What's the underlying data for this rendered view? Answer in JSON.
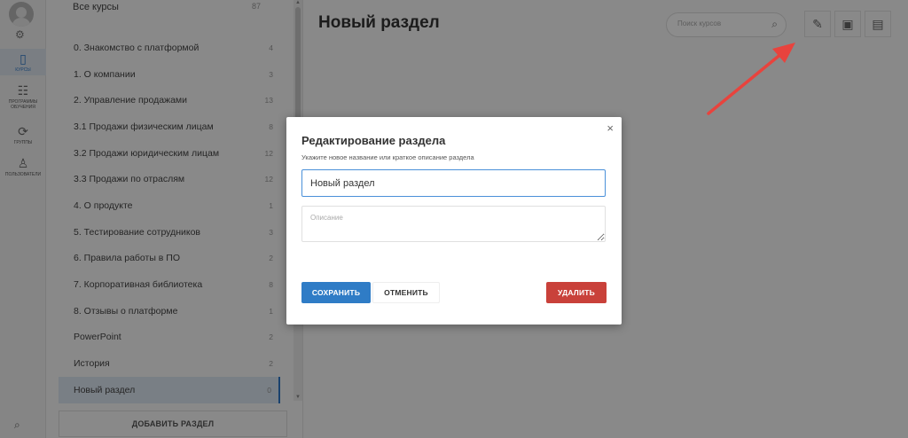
{
  "nav": {
    "items": [
      {
        "icon": "book-icon",
        "label": "КУРСЫ",
        "active": true
      },
      {
        "icon": "list-icon",
        "label": "ПРОГРАММЫ ОБУЧЕНИЯ",
        "active": false
      },
      {
        "icon": "groups-icon",
        "label": "ГРУППЫ",
        "active": false
      },
      {
        "icon": "users-icon",
        "label": "ПОЛЬЗОВАТЕЛИ",
        "active": false
      }
    ]
  },
  "sidebar": {
    "all_courses": {
      "label": "Все курсы",
      "count": "87"
    },
    "sections": [
      {
        "label": "0. Знакомство с платформой",
        "count": "4"
      },
      {
        "label": "1. О компании",
        "count": "3"
      },
      {
        "label": "2. Управление продажами",
        "count": "13"
      },
      {
        "label": "3.1 Продажи физическим лицам",
        "count": "8"
      },
      {
        "label": "3.2 Продажи юридическим лицам",
        "count": "12"
      },
      {
        "label": "3.3 Продажи по отраслям",
        "count": "12"
      },
      {
        "label": "4. О продукте",
        "count": "1"
      },
      {
        "label": "5. Тестирование сотрудников",
        "count": "3"
      },
      {
        "label": "6. Правила работы в ПО",
        "count": "2"
      },
      {
        "label": "7. Корпоративная библиотека",
        "count": "8"
      },
      {
        "label": "8. Отзывы о платформе",
        "count": "1"
      },
      {
        "label": "PowerPoint",
        "count": "2"
      },
      {
        "label": "История",
        "count": "2"
      },
      {
        "label": "Новый раздел",
        "count": "0"
      }
    ],
    "add_section_label": "ДОБАВИТЬ РАЗДЕЛ"
  },
  "main": {
    "title": "Новый раздел",
    "search_placeholder": "Поиск курсов"
  },
  "modal": {
    "title": "Редактирование раздела",
    "subtitle": "Укажите новое название или краткое описание раздела",
    "name_value": "Новый раздел",
    "description_placeholder": "Описание",
    "save_label": "СОХРАНИТЬ",
    "cancel_label": "ОТМЕНИТЬ",
    "delete_label": "УДАЛИТЬ"
  },
  "colors": {
    "accent": "#2f7cc6",
    "danger": "#c9413a",
    "annotation_arrow": "#e8433d"
  }
}
